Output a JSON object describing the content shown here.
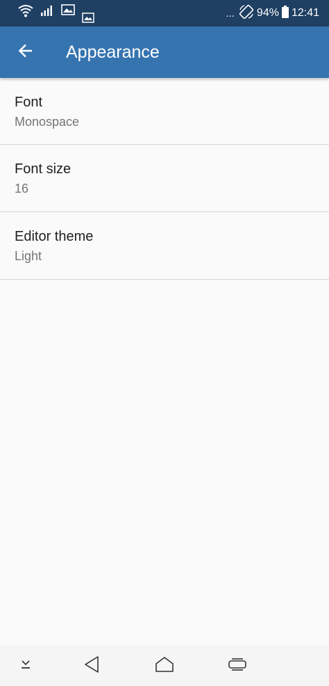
{
  "status_bar": {
    "dots": "...",
    "battery_percent": "94%",
    "time": "12:41"
  },
  "app_bar": {
    "title": "Appearance",
    "color": "#3674b0"
  },
  "preferences": [
    {
      "title": "Font",
      "summary": "Monospace"
    },
    {
      "title": "Font size",
      "summary": "16"
    },
    {
      "title": "Editor theme",
      "summary": "Light"
    }
  ],
  "icons": {
    "wifi": "wifi-icon",
    "signal": "signal-icon",
    "image1": "image-icon",
    "image2": "image-icon",
    "rotate": "auto-rotate-icon",
    "battery": "battery-icon",
    "back": "arrow-back-icon",
    "nav_down": "chevron-down-icon",
    "nav_back": "triangle-back-icon",
    "nav_home": "home-icon",
    "nav_recents": "recents-icon"
  }
}
